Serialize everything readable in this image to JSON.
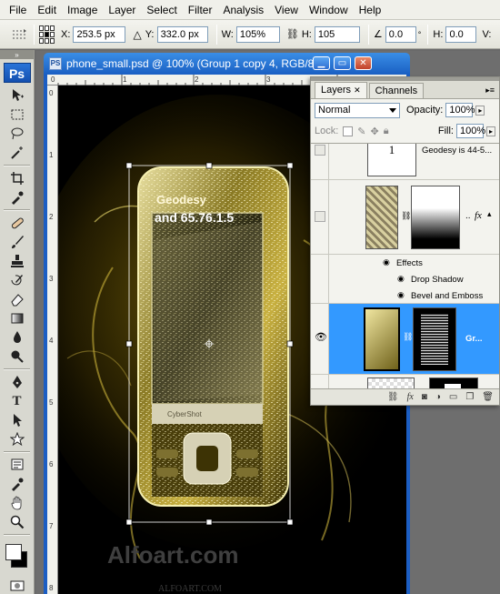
{
  "menu": [
    "File",
    "Edit",
    "Image",
    "Layer",
    "Select",
    "Filter",
    "Analysis",
    "View",
    "Window",
    "Help"
  ],
  "options_bar": {
    "x_label": "X:",
    "x_value": "253.5 px",
    "y_label": "Y:",
    "y_value": "332.0 px",
    "w_label": "W:",
    "w_value": "105%",
    "h_label": "H:",
    "h_value": "105",
    "angle_value": "0.0",
    "hskew_label": "H:",
    "hskew_value": "0.0",
    "vskew_label": "V:"
  },
  "toolbar": {
    "logo": "Ps"
  },
  "document": {
    "title": "phone_small.psd @ 100% (Group 1 copy 4, RGB/8*)",
    "ruler_top": [
      "0",
      "1",
      "2",
      "3",
      "4",
      "5"
    ],
    "ruler_left": [
      "0",
      "1",
      "2",
      "3",
      "4",
      "5",
      "6",
      "7",
      "8"
    ],
    "watermark": "Alfoart.com",
    "watermark_small": "ALFOART.COM",
    "screen_text": [
      "Geodesy",
      "and 65.76.1.5"
    ],
    "phone_brand": "CyberShot"
  },
  "layers_panel": {
    "tabs": [
      "Layers",
      "Channels"
    ],
    "blend_mode": "Normal",
    "opacity_label": "Opacity:",
    "opacity_value": "100%",
    "lock_label": "Lock:",
    "fill_label": "Fill:",
    "fill_value": "100%",
    "layers": [
      {
        "name": "Geodesy is 44-5...",
        "type": "text",
        "thumb_glyph": "1"
      },
      {
        "name": "",
        "type": "masked",
        "fx": "fx"
      },
      {
        "name": "Effects",
        "type": "effects-header"
      },
      {
        "name": "Drop Shadow",
        "type": "effect"
      },
      {
        "name": "Bevel and Emboss",
        "type": "effect"
      },
      {
        "name": "Gr...",
        "type": "group-selected"
      },
      {
        "name": "",
        "type": "masked"
      }
    ],
    "footer_fx": "fx"
  },
  "colors": {
    "selection_blue": "#3399ff",
    "title_blue": "#1c5ec3",
    "phone_gold": "#c8b040",
    "glow_gold": "#e2c220"
  }
}
